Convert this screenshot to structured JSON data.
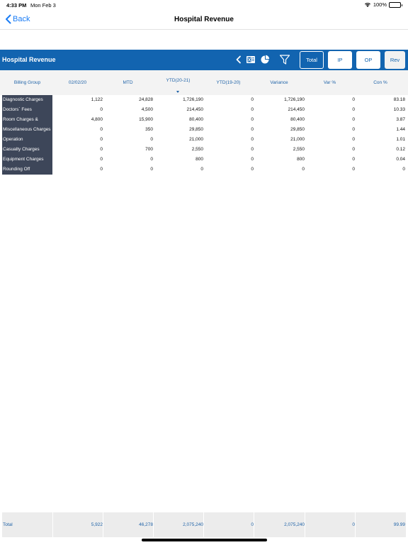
{
  "status_bar": {
    "time": "4:33 PM",
    "date": "Mon Feb 3",
    "battery": "100%"
  },
  "nav": {
    "back_label": "Back",
    "title": "Hospital Revenue"
  },
  "report": {
    "title": "Hospital Revenue",
    "buttons": {
      "total": "Total",
      "ip": "IP",
      "op": "OP",
      "rev": "Rev"
    }
  },
  "table": {
    "columns": [
      "Billing Group",
      "02/02/20",
      "MTD",
      "YTD(20-21)",
      "YTD(19-20)",
      "Variance",
      "Var %",
      "Con %"
    ],
    "sorted_column": "YTD(20-21)",
    "rows": [
      {
        "group": "Diagnostic Charges",
        "values": [
          "1,122",
          "24,828",
          "1,726,190",
          "0",
          "1,726,190",
          "0",
          "83.18"
        ]
      },
      {
        "group": "Doctors` Fees",
        "values": [
          "0",
          "4,500",
          "214,450",
          "0",
          "214,450",
          "0",
          "10.33"
        ]
      },
      {
        "group": "Room Charges &",
        "values": [
          "4,800",
          "15,900",
          "80,400",
          "0",
          "80,400",
          "0",
          "3.87"
        ]
      },
      {
        "group": "Miscellaneous Charges",
        "values": [
          "0",
          "350",
          "29,850",
          "0",
          "29,850",
          "0",
          "1.44"
        ]
      },
      {
        "group": "Operation",
        "values": [
          "0",
          "0",
          "21,000",
          "0",
          "21,000",
          "0",
          "1.01"
        ]
      },
      {
        "group": "Casualty Charges",
        "values": [
          "0",
          "700",
          "2,550",
          "0",
          "2,550",
          "0",
          "0.12"
        ]
      },
      {
        "group": "Equipment Charges",
        "values": [
          "0",
          "0",
          "800",
          "0",
          "800",
          "0",
          "0.04"
        ]
      },
      {
        "group": "Rounding Off",
        "values": [
          "0",
          "0",
          "0",
          "0",
          "0",
          "0",
          "0"
        ]
      }
    ],
    "total": {
      "label": "Total",
      "values": [
        "5,922",
        "46,278",
        "2,075,240",
        "0",
        "2,075,240",
        "0",
        "99.99"
      ]
    }
  },
  "colors": {
    "header_blue": "#1264b0",
    "label_column": "#3d4659",
    "link_blue": "#1a7cf5",
    "column_text": "#1f63a8"
  },
  "icons": [
    "chevron-left-icon",
    "excel-icon",
    "pie-chart-icon",
    "filter-icon",
    "wifi-icon",
    "battery-icon"
  ]
}
